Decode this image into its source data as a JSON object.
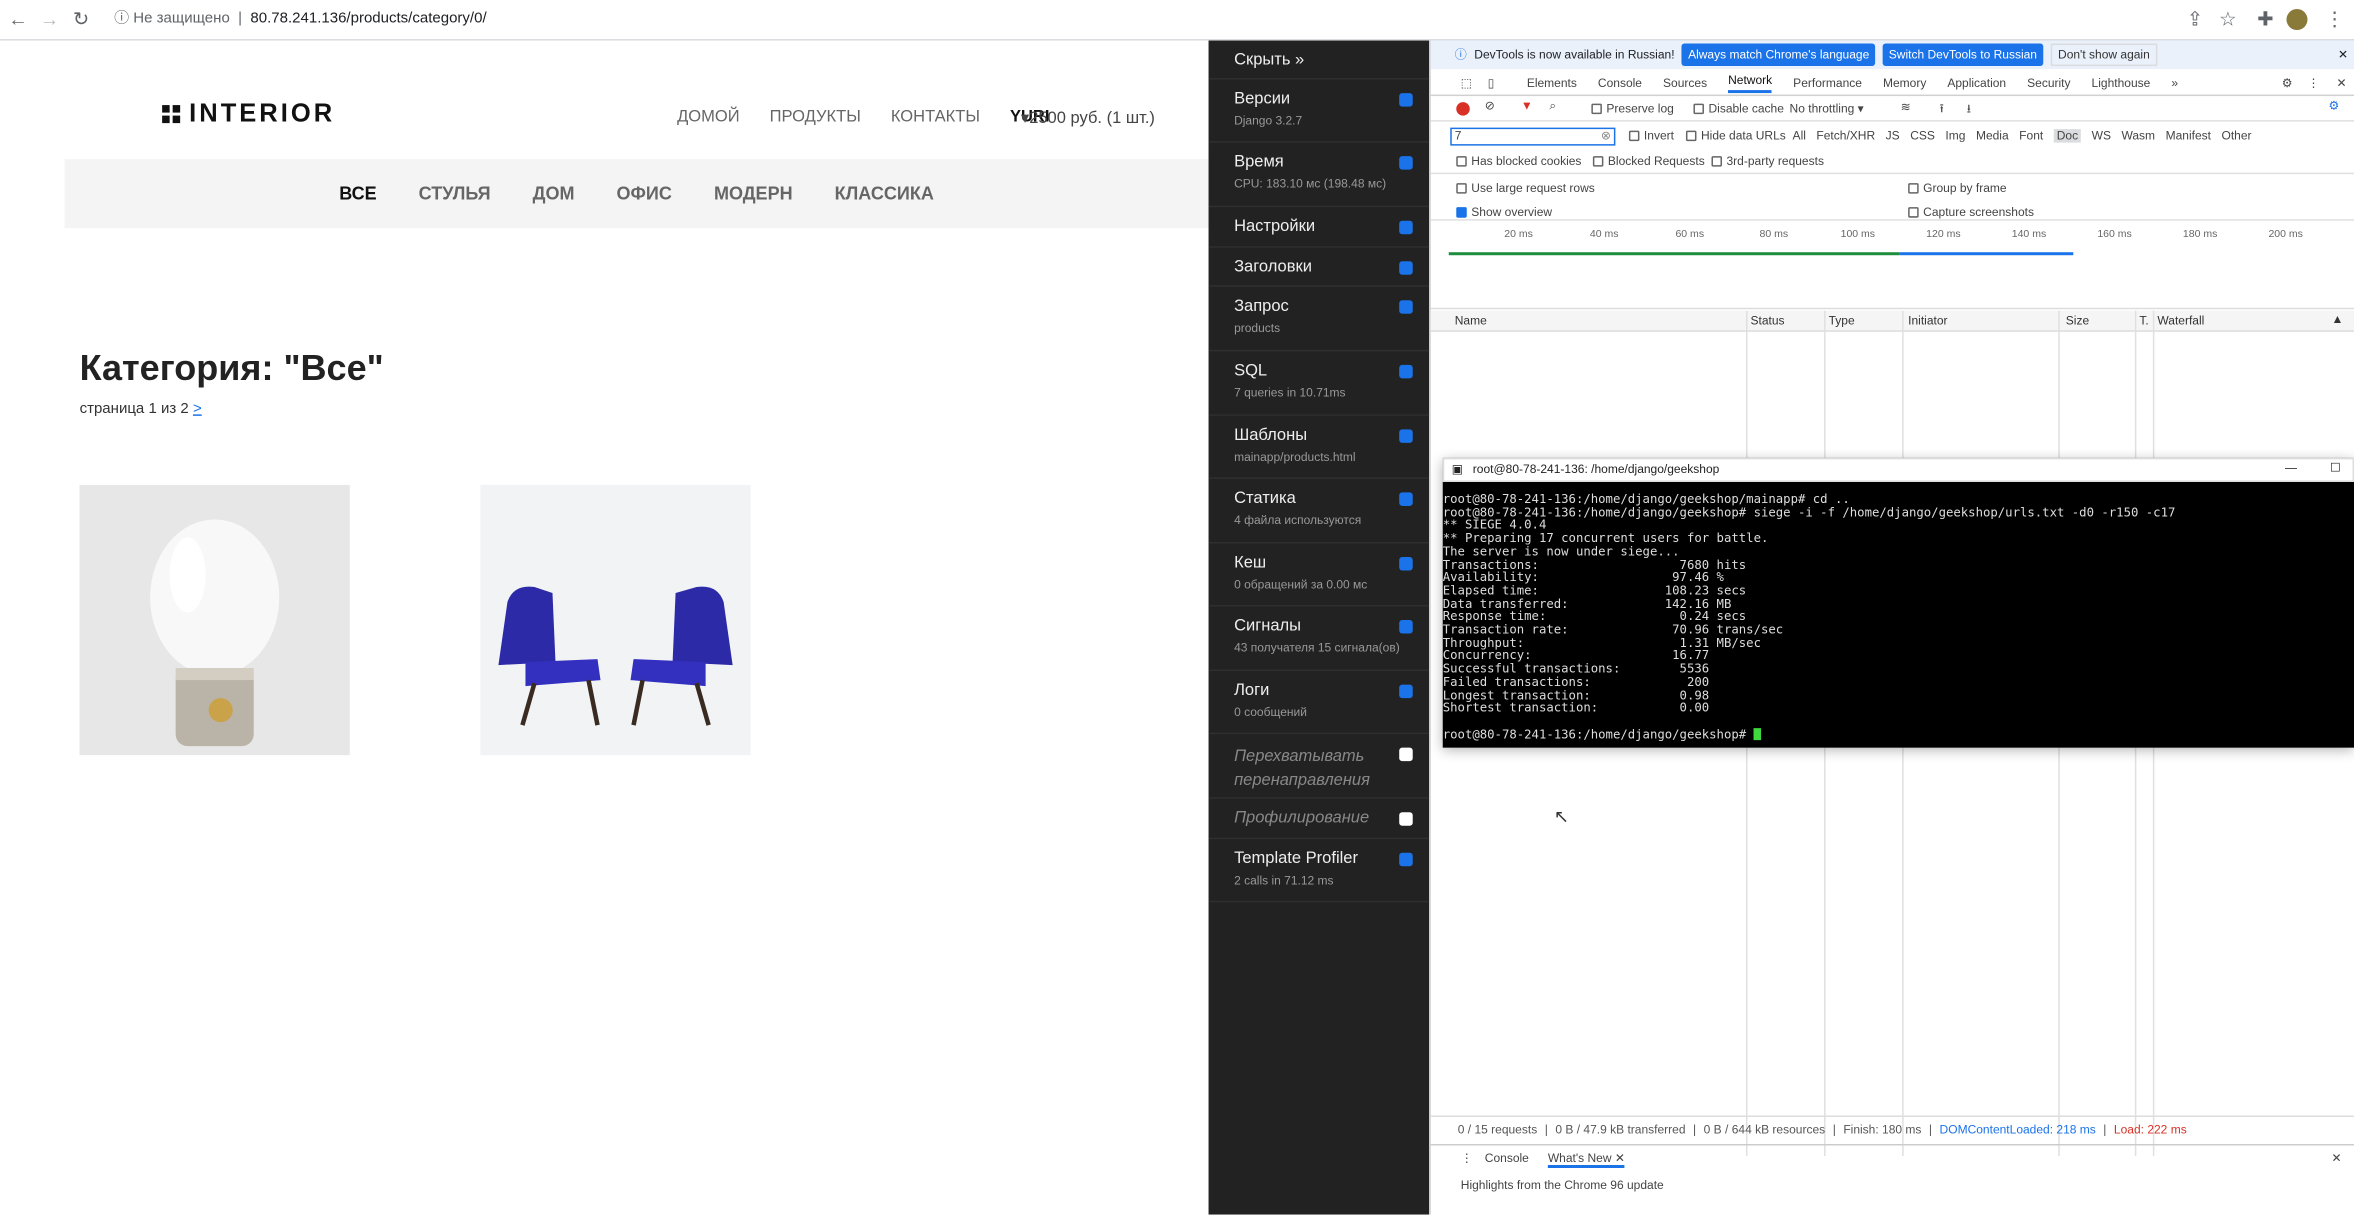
{
  "browser": {
    "security": "Не защищено",
    "url": "80.78.241.136/products/category/0/"
  },
  "site": {
    "logo": "INTERIOR",
    "nav": [
      "ДОМОЙ",
      "ПРОДУКТЫ",
      "КОНТАКТЫ"
    ],
    "user": "YURI",
    "cart": "2500 руб. (1 шт.)",
    "categories": [
      "ВСЕ",
      "СТУЛЬЯ",
      "ДОМ",
      "ОФИС",
      "МОДЕРН",
      "КЛАССИКА"
    ],
    "heading": "Категория: \"Все\"",
    "pager_text": "страница 1 из 2",
    "pager_next": ">"
  },
  "djdt": {
    "hide": "Скрыть »",
    "panels": [
      {
        "title": "Версии",
        "sub": "Django 3.2.7",
        "checked": true
      },
      {
        "title": "Время",
        "sub": "CPU: 183.10 мс (198.48 мс)",
        "checked": true
      },
      {
        "title": "Настройки",
        "sub": "",
        "checked": true
      },
      {
        "title": "Заголовки",
        "sub": "",
        "checked": true
      },
      {
        "title": "Запрос",
        "sub": "products",
        "checked": true
      },
      {
        "title": "SQL",
        "sub": "7 queries in 10.71ms",
        "checked": true
      },
      {
        "title": "Шаблоны",
        "sub": "mainapp/products.html",
        "checked": true
      },
      {
        "title": "Статика",
        "sub": "4 файла используются",
        "checked": true
      },
      {
        "title": "Кеш",
        "sub": "0 обращений за 0.00 мс",
        "checked": true
      },
      {
        "title": "Сигналы",
        "sub": "43 получателя 15 сигнала(ов)",
        "checked": true
      },
      {
        "title": "Логи",
        "sub": "0 сообщений",
        "checked": true
      },
      {
        "title": "Перехватывать перенаправления",
        "sub": "",
        "checked": false
      },
      {
        "title": "Профилирование",
        "sub": "",
        "checked": false
      },
      {
        "title": "Template Profiler",
        "sub": "2 calls in 71.12 ms",
        "checked": true
      }
    ]
  },
  "devtools": {
    "banner": "DevTools is now available in Russian!",
    "banner_btn1": "Always match Chrome's language",
    "banner_btn2": "Switch DevTools to Russian",
    "banner_btn3": "Don't show again",
    "tabs": [
      "Elements",
      "Console",
      "Sources",
      "Network",
      "Performance",
      "Memory",
      "Application",
      "Security",
      "Lighthouse"
    ],
    "toolbar": {
      "preserve": "Preserve log",
      "disable": "Disable cache",
      "throttle": "No throttling"
    },
    "filter": {
      "value": "7",
      "invert": "Invert",
      "hide_data": "Hide data URLs",
      "types": [
        "All",
        "Fetch/XHR",
        "JS",
        "CSS",
        "Img",
        "Media",
        "Font",
        "Doc",
        "WS",
        "Wasm",
        "Manifest",
        "Other"
      ],
      "blocked_cookies": "Has blocked cookies",
      "blocked_req": "Blocked Requests",
      "third": "3rd-party requests"
    },
    "opts": {
      "large": "Use large request rows",
      "group": "Group by frame",
      "overview": "Show overview",
      "capture": "Capture screenshots"
    },
    "ticks": [
      "20 ms",
      "40 ms",
      "60 ms",
      "80 ms",
      "100 ms",
      "120 ms",
      "140 ms",
      "160 ms",
      "180 ms",
      "200 ms"
    ],
    "columns": [
      "Name",
      "Status",
      "Type",
      "Initiator",
      "Size",
      "T.",
      "Waterfall"
    ],
    "status": {
      "requests": "0 / 15 requests",
      "transferred": "0 B / 47.9 kB transferred",
      "resources": "0 B / 644 kB resources",
      "finish": "Finish: 180 ms",
      "dcl": "DOMContentLoaded: 218 ms",
      "load": "Load: 222 ms"
    },
    "drawer": {
      "tab1": "Console",
      "tab2": "What's New",
      "text": "Highlights from the Chrome 96 update"
    }
  },
  "terminal": {
    "title": "root@80-78-241-136: /home/django/geekshop",
    "lines": [
      "root@80-78-241-136:/home/django/geekshop/mainapp# cd ..",
      "root@80-78-241-136:/home/django/geekshop# siege -i -f /home/django/geekshop/urls.txt -d0 -r150 -c17",
      "** SIEGE 4.0.4",
      "** Preparing 17 concurrent users for battle.",
      "The server is now under siege...",
      "Transactions:                   7680 hits",
      "Availability:                  97.46 %",
      "Elapsed time:                 108.23 secs",
      "Data transferred:             142.16 MB",
      "Response time:                  0.24 secs",
      "Transaction rate:              70.96 trans/sec",
      "Throughput:                     1.31 MB/sec",
      "Concurrency:                   16.77",
      "Successful transactions:        5536",
      "Failed transactions:             200",
      "Longest transaction:            0.98",
      "Shortest transaction:           0.00",
      "",
      "root@80-78-241-136:/home/django/geekshop# "
    ]
  }
}
